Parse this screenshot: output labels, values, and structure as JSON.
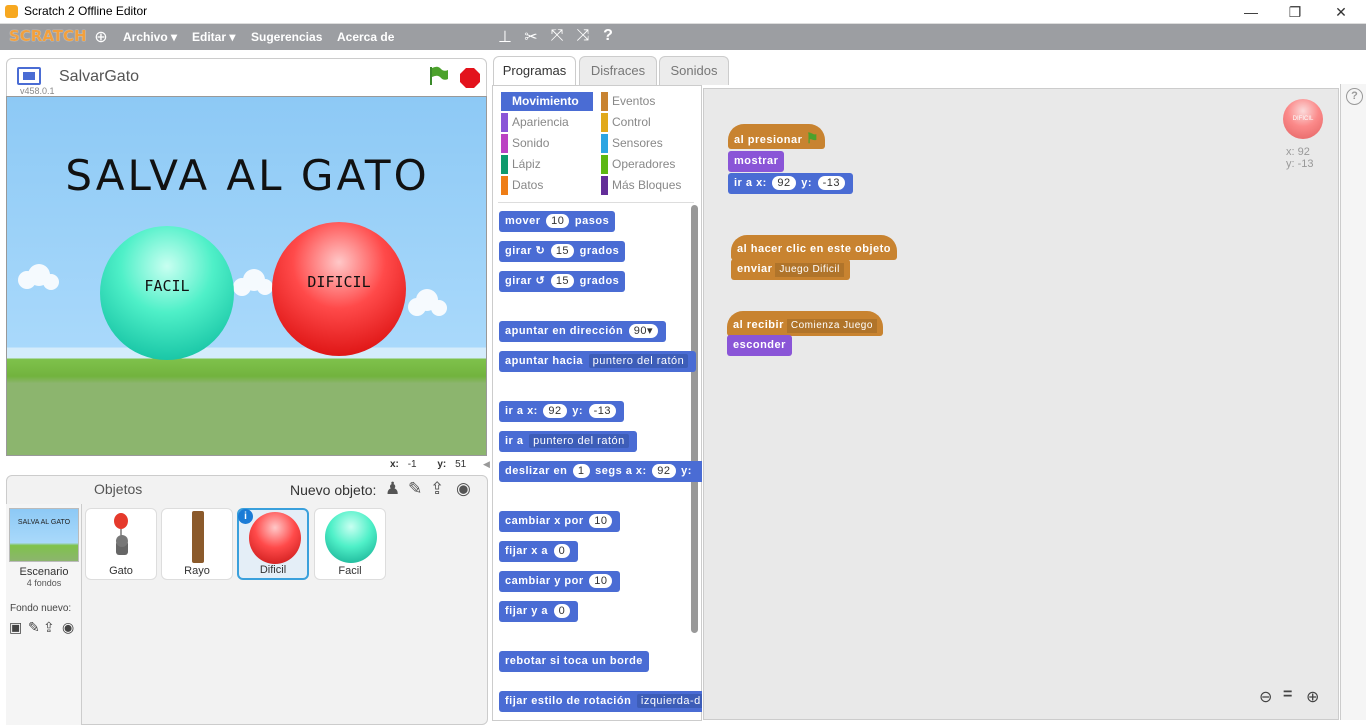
{
  "window": {
    "title": "Scratch 2 Offline Editor",
    "min": "—",
    "max": "❐",
    "close": "✕"
  },
  "menubar": {
    "logo": "SCRATCH",
    "items": [
      "Archivo ▾",
      "Editar ▾",
      "Sugerencias",
      "Acerca de"
    ]
  },
  "stage": {
    "sprite_name": "SalvarGato",
    "version": "v458.0.1",
    "title": "SALVA AL GATO",
    "easy_label": "FACIL",
    "hard_label": "DIFICIL",
    "x_label": "x:",
    "x_value": "-1",
    "y_label": "y:",
    "y_value": "51"
  },
  "sprites": {
    "header": "Objetos",
    "new_object": "Nuevo objeto:",
    "stage_label": "Escenario",
    "stage_count": "4 fondos",
    "new_backdrop": "Fondo nuevo:",
    "items": [
      "Gato",
      "Rayo",
      "Dificil",
      "Facil"
    ],
    "thumb_title": "SALVA AL GATO",
    "selected": "Dificil"
  },
  "tabs": [
    "Programas",
    "Disfraces",
    "Sonidos"
  ],
  "categories": {
    "left": [
      "Movimiento",
      "Apariencia",
      "Sonido",
      "Lápiz",
      "Datos"
    ],
    "right": [
      "Eventos",
      "Control",
      "Sensores",
      "Operadores",
      "Más Bloques"
    ],
    "colors": [
      "#4a6cd4",
      "#8a55d7",
      "#bb42c3",
      "#0e9a6c",
      "#ee7d16",
      "#c88330",
      "#e1a91a",
      "#2ca5e2",
      "#5cb712",
      "#632d99"
    ]
  },
  "palette": {
    "mover": "mover",
    "pasos": "pasos",
    "mover_val": "10",
    "girar": "girar",
    "grados": "grados",
    "girar_val": "15",
    "apuntar_dir": "apuntar en dirección",
    "dir_val": "90▾",
    "apuntar_hacia": "apuntar hacia",
    "puntero": "puntero del ratón",
    "ir_a_x": "ir a x:",
    "y": "y:",
    "x_val": "92",
    "y_val": "-13",
    "ir_a": "ir a",
    "deslizar": "deslizar en",
    "segs": "segs a x:",
    "seg_val": "1",
    "cambiar_x": "cambiar x por",
    "fijar_x": "fijar x a",
    "cambiar_y": "cambiar y por",
    "fijar_y": "fijar y a",
    "ten": "10",
    "zero": "0",
    "rebotar": "rebotar si toca un borde",
    "estilo": "fijar estilo de rotación",
    "estilo_val": "izquierda-d"
  },
  "scripts": {
    "al_presionar": "al presionar",
    "mostrar": "mostrar",
    "ir_a_x": "ir a x:",
    "y": "y:",
    "x_val": "92",
    "y_val": "-13",
    "al_hacer_clic": "al hacer clic en este objeto",
    "enviar": "enviar",
    "enviar_val": "Juego Dificil",
    "al_recibir": "al recibir",
    "recibir_val": "Comienza Juego",
    "esconder": "esconder",
    "sprite_x": "x: 92",
    "sprite_y": "y: -13",
    "thumb_label": "DIFICIL"
  }
}
